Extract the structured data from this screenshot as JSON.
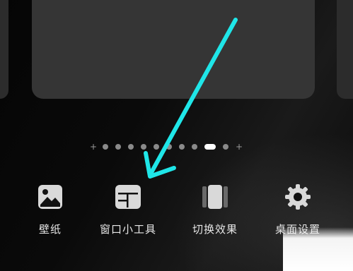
{
  "menu": {
    "items": [
      {
        "label": "壁纸",
        "icon": "wallpaper-icon"
      },
      {
        "label": "窗口小工具",
        "icon": "widget-icon"
      },
      {
        "label": "切换效果",
        "icon": "transition-effect-icon"
      },
      {
        "label": "桌面设置",
        "icon": "gear-icon"
      }
    ]
  },
  "page_indicator": {
    "total_pages": 10,
    "current_page": 9,
    "has_add_buttons": true
  },
  "annotation": {
    "type": "arrow",
    "color": "#1fe6e8",
    "points_to": "widget-icon"
  },
  "colors": {
    "background": "#000000",
    "card": "#353535",
    "text": "#e6e6e6"
  }
}
